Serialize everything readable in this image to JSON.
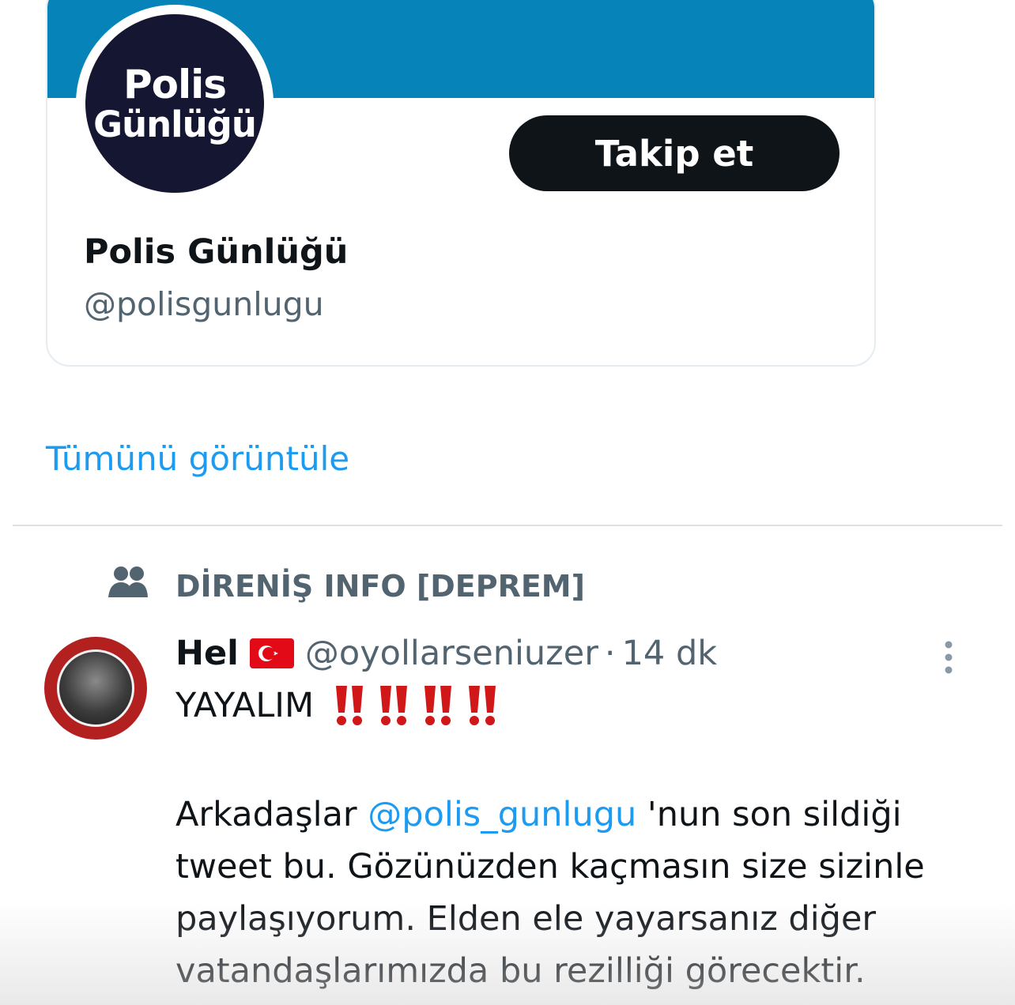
{
  "profile_card": {
    "avatar_line1": "Polis",
    "avatar_line2": "Günlüğü",
    "follow_label": "Takip et",
    "name": "Polis Günlüğü",
    "handle": "@polisgunlugu",
    "banner_color": "#0683b8"
  },
  "show_all_label": "Tümünü görüntüle",
  "community": {
    "icon": "people-icon",
    "label": "DİRENİŞ INFO [DEPREM]"
  },
  "tweet": {
    "author": "Hel",
    "flag_icon": "turkey-flag-icon",
    "handle": "@oyollarseniuzer",
    "separator": "·",
    "time": "14 dk",
    "title": "YAYALIM",
    "title_emoji_icon": "double-exclamation-icon",
    "title_emoji_count": 4,
    "body_before_mention": "Arkadaşlar ",
    "mention": "@polis_gunlugu",
    "body_after_mention": " 'nun son sildiği tweet bu.  Gözünüzden kaçmasın size sizinle paylaşıyorum. Elden ele yayarsanız diğer vatandaşlarımızda bu rezilliği görecektir.",
    "mention_color": "#1d9bf0",
    "more_icon": "more-vertical-icon"
  }
}
